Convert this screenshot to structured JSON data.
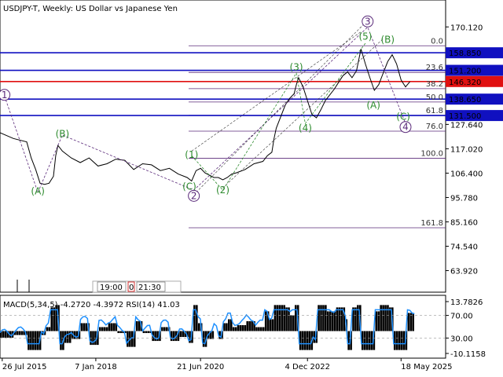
{
  "header": {
    "title": "USDJPY-T, Weekly:  US Dollar vs Japanese Yen"
  },
  "indicator": {
    "caption": "MACD(5,34,5) -4.2720 -4.3972 RSI(14) 41.03"
  },
  "timebox": {
    "start": "19:00",
    "mid": "0",
    "end": "21:30"
  },
  "colors": {
    "up_level": "#1010c0",
    "current_price": "#e01010",
    "fib": "#5a2a7a",
    "wave_label": "#2e8b2e",
    "rsi": "#1e90ff"
  },
  "chart_data": {
    "type": "line",
    "symbol": "USDJPY-T",
    "timeframe": "Weekly",
    "ylim": [
      60.0,
      175.0
    ],
    "y_ticks": [
      "170.120",
      "127.640",
      "117.020",
      "106.400",
      "95.780",
      "85.160",
      "74.540",
      "63.920"
    ],
    "x_ticks": [
      "26 Jul 2015",
      "7 Jan 2018",
      "21 Jun 2020",
      "4 Dec 2022",
      "18 May 2025"
    ],
    "price_series": [
      [
        0,
        124.0
      ],
      [
        0.03,
        121.5
      ],
      [
        0.06,
        120.0
      ],
      [
        0.07,
        113.0
      ],
      [
        0.08,
        108.0
      ],
      [
        0.09,
        102.0
      ],
      [
        0.1,
        101.5
      ],
      [
        0.11,
        102.0
      ],
      [
        0.12,
        105.0
      ],
      [
        0.125,
        114.0
      ],
      [
        0.13,
        118.5
      ],
      [
        0.14,
        116.0
      ],
      [
        0.16,
        113.0
      ],
      [
        0.18,
        111.0
      ],
      [
        0.2,
        113.0
      ],
      [
        0.22,
        109.5
      ],
      [
        0.24,
        110.5
      ],
      [
        0.26,
        112.5
      ],
      [
        0.28,
        112.0
      ],
      [
        0.3,
        108.0
      ],
      [
        0.32,
        110.5
      ],
      [
        0.34,
        110.0
      ],
      [
        0.36,
        107.5
      ],
      [
        0.38,
        108.5
      ],
      [
        0.4,
        106.0
      ],
      [
        0.42,
        104.5
      ],
      [
        0.43,
        103.0
      ],
      [
        0.44,
        107.5
      ],
      [
        0.45,
        108.5
      ],
      [
        0.46,
        106.5
      ],
      [
        0.47,
        105.5
      ],
      [
        0.48,
        104.5
      ],
      [
        0.49,
        104.5
      ],
      [
        0.5,
        103.5
      ],
      [
        0.51,
        104.5
      ],
      [
        0.52,
        106.0
      ],
      [
        0.53,
        106.5
      ],
      [
        0.55,
        108.0
      ],
      [
        0.57,
        110.5
      ],
      [
        0.59,
        111.5
      ],
      [
        0.6,
        114.0
      ],
      [
        0.61,
        115.5
      ],
      [
        0.615,
        121.5
      ],
      [
        0.62,
        126.0
      ],
      [
        0.63,
        131.0
      ],
      [
        0.64,
        136.0
      ],
      [
        0.65,
        139.0
      ],
      [
        0.66,
        141.0
      ],
      [
        0.665,
        145.0
      ],
      [
        0.67,
        148.0
      ],
      [
        0.68,
        144.0
      ],
      [
        0.69,
        138.0
      ],
      [
        0.7,
        132.0
      ],
      [
        0.71,
        130.5
      ],
      [
        0.72,
        134.0
      ],
      [
        0.73,
        138.0
      ],
      [
        0.74,
        140.5
      ],
      [
        0.75,
        143.0
      ],
      [
        0.76,
        146.0
      ],
      [
        0.77,
        149.0
      ],
      [
        0.78,
        150.5
      ],
      [
        0.79,
        148.0
      ],
      [
        0.8,
        151.0
      ],
      [
        0.81,
        160.5
      ],
      [
        0.82,
        154.0
      ],
      [
        0.83,
        148.0
      ],
      [
        0.84,
        142.5
      ],
      [
        0.85,
        145.0
      ],
      [
        0.86,
        150.0
      ],
      [
        0.87,
        155.0
      ],
      [
        0.88,
        158.0
      ],
      [
        0.89,
        154.0
      ],
      [
        0.9,
        147.0
      ],
      [
        0.91,
        144.0
      ],
      [
        0.92,
        146.3
      ]
    ],
    "levels": [
      {
        "price": 158.85,
        "label": "158.850",
        "kind": "support-resistance"
      },
      {
        "price": 151.2,
        "label": "151.200",
        "kind": "support-resistance"
      },
      {
        "price": 146.32,
        "label": "146.320",
        "kind": "current-price"
      },
      {
        "price": 138.65,
        "label": "138.650",
        "kind": "support-resistance"
      },
      {
        "price": 131.5,
        "label": "131.500",
        "kind": "support-resistance"
      }
    ],
    "fibonacci": [
      {
        "ratio": "0.0",
        "price": 161.9
      },
      {
        "ratio": "23.6",
        "price": 150.3
      },
      {
        "ratio": "38.2",
        "price": 143.2
      },
      {
        "ratio": "50.0",
        "price": 137.4
      },
      {
        "ratio": "61.8",
        "price": 131.6
      },
      {
        "ratio": "76.0",
        "price": 124.7
      },
      {
        "ratio": "100.0",
        "price": 112.9
      },
      {
        "ratio": "161.8",
        "price": 82.6
      }
    ],
    "wave_labels": [
      {
        "text": "(A)",
        "t": 0.085,
        "p": 98.5,
        "style": "minor"
      },
      {
        "text": "(B)",
        "t": 0.14,
        "p": 123.5,
        "style": "minor"
      },
      {
        "text": "(1)",
        "t": 0.43,
        "p": 114.5,
        "style": "minor"
      },
      {
        "text": "(C)",
        "t": 0.425,
        "p": 100.5,
        "style": "minor"
      },
      {
        "text": "(2)",
        "t": 0.5,
        "p": 99.0,
        "style": "minor"
      },
      {
        "text": "(3)",
        "t": 0.665,
        "p": 152.5,
        "style": "minor"
      },
      {
        "text": "(4)",
        "t": 0.685,
        "p": 126.0,
        "style": "minor"
      },
      {
        "text": "(5)",
        "t": 0.82,
        "p": 166.0,
        "style": "minor"
      },
      {
        "text": "(A)",
        "t": 0.838,
        "p": 136.0,
        "style": "minor"
      },
      {
        "text": "(B)",
        "t": 0.87,
        "p": 164.5,
        "style": "minor"
      },
      {
        "text": "(C)",
        "t": 0.905,
        "p": 131.0,
        "style": "minor"
      },
      {
        "text": "3",
        "t": 0.825,
        "p": 172.5,
        "style": "major"
      },
      {
        "text": "2",
        "t": 0.435,
        "p": 96.5,
        "style": "major"
      },
      {
        "text": "4",
        "t": 0.91,
        "p": 126.5,
        "style": "major"
      },
      {
        "text": "1",
        "t": 0.01,
        "p": 140.5,
        "style": "major"
      }
    ],
    "indicator": {
      "name": "MACD/RSI",
      "y_ticks": [
        "13.7826",
        "70.00",
        "30.00",
        "-10.1158"
      ],
      "ylim": [
        -10.1158,
        13.7826
      ],
      "rsi_levels": [
        70.0,
        30.0
      ],
      "macd": -4.272,
      "signal": -4.3972,
      "rsi": 41.03
    }
  }
}
